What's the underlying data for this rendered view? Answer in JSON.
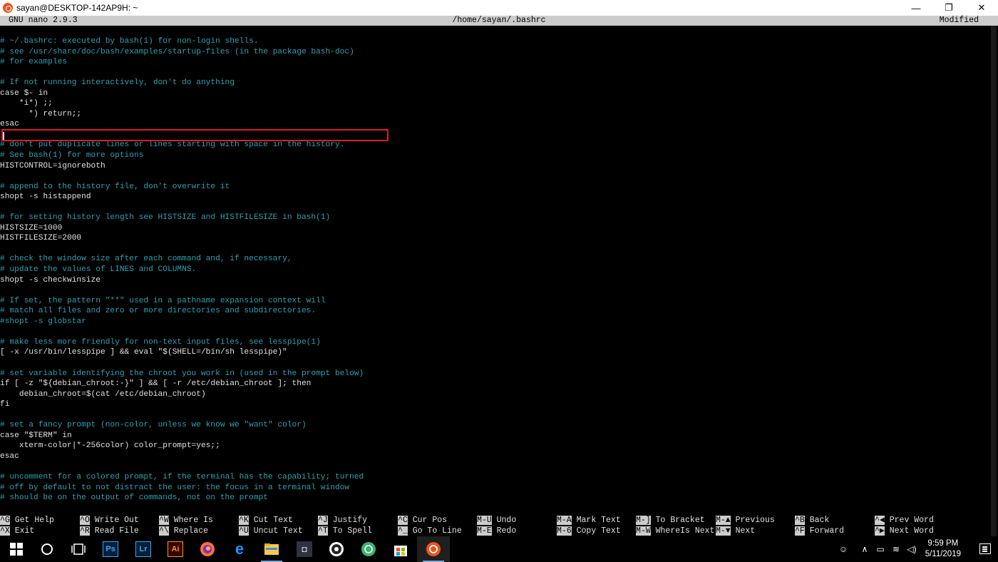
{
  "window": {
    "title": "sayan@DESKTOP-142AP9H: ~",
    "minimize": "—",
    "restore": "❐",
    "close": "✕"
  },
  "nano": {
    "version": "GNU nano 2.9.3",
    "file": "/home/sayan/.bashrc",
    "status": "Modified"
  },
  "lines": [
    {
      "t": "# ~/.bashrc: executed by bash(1) for non-login shells.",
      "c": "comment"
    },
    {
      "t": "# see /usr/share/doc/bash/examples/startup-files (in the package bash-doc)",
      "c": "comment"
    },
    {
      "t": "# for examples",
      "c": "comment"
    },
    {
      "t": "",
      "c": "code"
    },
    {
      "t": "# If not running interactively, don't do anything",
      "c": "comment"
    },
    {
      "t": "case $- in",
      "c": "code"
    },
    {
      "t": "    *i*) ;;",
      "c": "code"
    },
    {
      "t": "      *) return;;",
      "c": "code"
    },
    {
      "t": "esac",
      "c": "code"
    },
    {
      "t": "",
      "c": "code"
    },
    {
      "t": "# don't put duplicate lines or lines starting with space in the history.",
      "c": "comment"
    },
    {
      "t": "# See bash(1) for more options",
      "c": "comment"
    },
    {
      "t": "HISTCONTROL=ignoreboth",
      "c": "code"
    },
    {
      "t": "",
      "c": "code"
    },
    {
      "t": "# append to the history file, don't overwrite it",
      "c": "comment"
    },
    {
      "t": "shopt -s histappend",
      "c": "code"
    },
    {
      "t": "",
      "c": "code"
    },
    {
      "t": "# for setting history length see HISTSIZE and HISTFILESIZE in bash(1)",
      "c": "comment"
    },
    {
      "t": "HISTSIZE=1000",
      "c": "code"
    },
    {
      "t": "HISTFILESIZE=2000",
      "c": "code"
    },
    {
      "t": "",
      "c": "code"
    },
    {
      "t": "# check the window size after each command and, if necessary,",
      "c": "comment"
    },
    {
      "t": "# update the values of LINES and COLUMNS.",
      "c": "comment"
    },
    {
      "t": "shopt -s checkwinsize",
      "c": "code"
    },
    {
      "t": "",
      "c": "code"
    },
    {
      "t": "# If set, the pattern \"**\" used in a pathname expansion context will",
      "c": "comment"
    },
    {
      "t": "# match all files and zero or more directories and subdirectories.",
      "c": "comment"
    },
    {
      "t": "#shopt -s globstar",
      "c": "comment"
    },
    {
      "t": "",
      "c": "code"
    },
    {
      "t": "# make less more friendly for non-text input files, see lesspipe(1)",
      "c": "comment"
    },
    {
      "t": "[ -x /usr/bin/lesspipe ] && eval \"$(SHELL=/bin/sh lesspipe)\"",
      "c": "code"
    },
    {
      "t": "",
      "c": "code"
    },
    {
      "t": "# set variable identifying the chroot you work in (used in the prompt below)",
      "c": "comment"
    },
    {
      "t": "if [ -z \"${debian_chroot:-}\" ] && [ -r /etc/debian_chroot ]; then",
      "c": "code"
    },
    {
      "t": "    debian_chroot=$(cat /etc/debian_chroot)",
      "c": "code"
    },
    {
      "t": "fi",
      "c": "code"
    },
    {
      "t": "",
      "c": "code"
    },
    {
      "t": "# set a fancy prompt (non-color, unless we know we \"want\" color)",
      "c": "comment"
    },
    {
      "t": "case \"$TERM\" in",
      "c": "code"
    },
    {
      "t": "    xterm-color|*-256color) color_prompt=yes;;",
      "c": "code"
    },
    {
      "t": "esac",
      "c": "code"
    },
    {
      "t": "",
      "c": "code"
    },
    {
      "t": "# uncomment for a colored prompt, if the terminal has the capability; turned",
      "c": "comment"
    },
    {
      "t": "# off by default to not distract the user: the focus in a terminal window",
      "c": "comment"
    },
    {
      "t": "# should be on the output of commands, not on the prompt",
      "c": "comment"
    }
  ],
  "shortcuts": [
    {
      "key": "^G",
      "label": "Get Help"
    },
    {
      "key": "^X",
      "label": "Exit"
    },
    {
      "key": "^O",
      "label": "Write Out"
    },
    {
      "key": "^R",
      "label": "Read File"
    },
    {
      "key": "^W",
      "label": "Where Is"
    },
    {
      "key": "^\\",
      "label": "Replace"
    },
    {
      "key": "^K",
      "label": "Cut Text"
    },
    {
      "key": "^U",
      "label": "Uncut Text"
    },
    {
      "key": "^J",
      "label": "Justify"
    },
    {
      "key": "^T",
      "label": "To Spell"
    },
    {
      "key": "^C",
      "label": "Cur Pos"
    },
    {
      "key": "^_",
      "label": "Go To Line"
    },
    {
      "key": "M-U",
      "label": "Undo"
    },
    {
      "key": "M-E",
      "label": "Redo"
    },
    {
      "key": "M-A",
      "label": "Mark Text"
    },
    {
      "key": "M-6",
      "label": "Copy Text"
    },
    {
      "key": "M-]",
      "label": "To Bracket"
    },
    {
      "key": "M-W",
      "label": "WhereIs Next"
    },
    {
      "key": "M-▲",
      "label": "Previous"
    },
    {
      "key": "M-▼",
      "label": "Next"
    },
    {
      "key": "^B",
      "label": "Back"
    },
    {
      "key": "^F",
      "label": "Forward"
    },
    {
      "key": "^◀",
      "label": "Prev Word"
    },
    {
      "key": "^▶",
      "label": "Next Word"
    }
  ],
  "taskbar": {
    "apps": [
      {
        "name": "windows-start",
        "icon": "windows-logo"
      },
      {
        "name": "cortana",
        "icon": "circle"
      },
      {
        "name": "task-view",
        "icon": "task-view"
      },
      {
        "name": "photoshop",
        "label": "Ps",
        "color": "#31a8ff"
      },
      {
        "name": "lightroom",
        "label": "Lr",
        "color": "#31a8ff"
      },
      {
        "name": "illustrator",
        "label": "Ai",
        "color": "#ff9a00"
      },
      {
        "name": "firefox",
        "icon": "firefox"
      },
      {
        "name": "edge",
        "icon": "edge"
      },
      {
        "name": "file-explorer",
        "icon": "folder"
      },
      {
        "name": "app-dark",
        "icon": "app"
      },
      {
        "name": "obs",
        "icon": "obs"
      },
      {
        "name": "app-green",
        "icon": "globe"
      },
      {
        "name": "store",
        "icon": "store"
      },
      {
        "name": "ubuntu",
        "icon": "ubuntu"
      }
    ],
    "time": "9:59 PM",
    "date": "5/11/2019"
  }
}
